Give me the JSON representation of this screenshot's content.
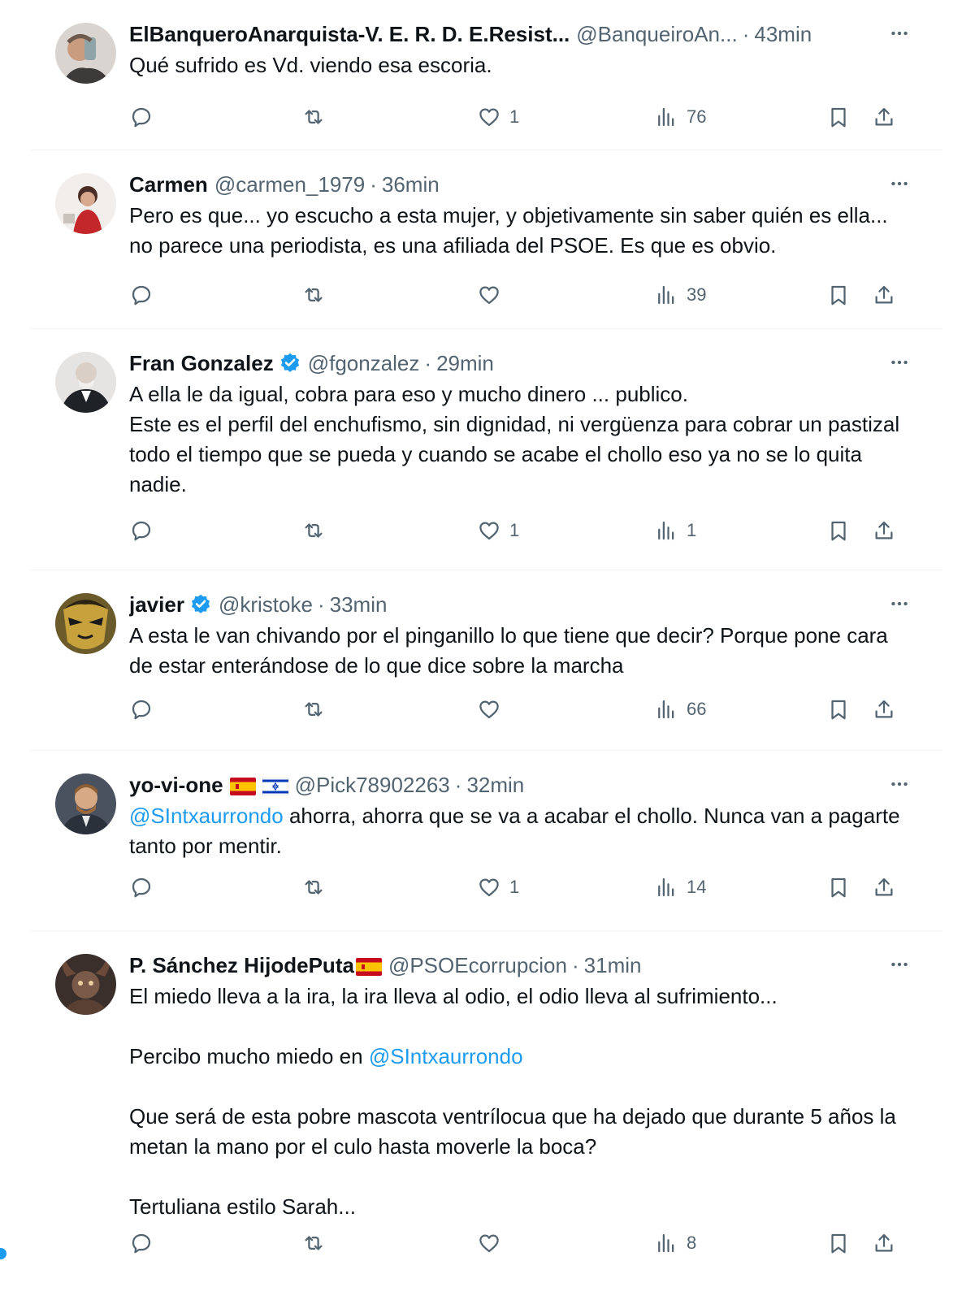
{
  "colors": {
    "text": "#0f1419",
    "secondary": "#536471",
    "link": "#1d9bf0",
    "divider": "#eff3f4"
  },
  "tweets": [
    {
      "name": "ElBanqueroAnarquista-V. E. R. D. E.Resist...",
      "handle": "@BanqueiroAn...",
      "sep": "·",
      "time": "43min",
      "verified": false,
      "text": "Qué sufrido es Vd. viendo esa escoria.",
      "likes": "1",
      "views": "76",
      "avatar": "avatar-man-drinking"
    },
    {
      "name": "Carmen",
      "handle": "@carmen_1979",
      "sep": "·",
      "time": "36min",
      "verified": false,
      "text": "Pero es que... yo escucho a esta mujer, y objetivamente sin saber quién es ella... no parece una periodista, es una afiliada del PSOE. Es que es obvio.",
      "likes": "",
      "views": "39",
      "avatar": "avatar-woman-red"
    },
    {
      "name": "Fran Gonzalez",
      "handle": "@fgonzalez",
      "sep": "·",
      "time": "29min",
      "verified": true,
      "line1": "A ella le da igual, cobra para eso y mucho dinero ... publico.",
      "line2": "Este es el perfil del enchufismo, sin dignidad, ni vergüenza para cobrar un pastizal todo el tiempo que se pueda y cuando se acabe el chollo eso ya no se lo quita nadie.",
      "likes": "1",
      "views": "1",
      "avatar": "avatar-bald-man"
    },
    {
      "name": "javier",
      "handle": "@kristoke",
      "sep": "·",
      "time": "33min",
      "verified": true,
      "text": "A esta le van chivando por el pinganillo lo que tiene que decir? Porque pone cara de estar enterándose de lo que dice sobre la marcha",
      "likes": "",
      "views": "66",
      "avatar": "avatar-cartoon-face"
    },
    {
      "name": "yo-vi-one",
      "handle": "@Pick78902263",
      "sep": "·",
      "time": "32min",
      "verified": false,
      "flags": [
        "flag-spain",
        "flag-israel"
      ],
      "mention": "@SIntxaurrondo",
      "text": " ahorra, ahorra que se va a acabar el chollo. Nunca van a pagarte tanto por mentir.",
      "likes": "1",
      "views": "14",
      "avatar": "avatar-bearded-man"
    },
    {
      "name": "P. Sánchez HijodePuta",
      "handle": "@PSOEcorrupcion",
      "sep": "·",
      "time": "31min",
      "verified": false,
      "flags": [
        "flag-spain"
      ],
      "para1": "El miedo lleva a la ira, la ira lleva al odio, el odio lleva al sufrimiento...",
      "para2_prefix": "Percibo mucho miedo en ",
      "para2_mention": "@SIntxaurrondo",
      "para3": "Que será de esta pobre mascota ventrílocua que ha dejado que durante 5 años la metan la mano por el culo hasta moverle la boca?",
      "para4": "Tertuliana estilo Sarah...",
      "likes": "",
      "views": "8",
      "avatar": "avatar-horned-figure"
    }
  ]
}
